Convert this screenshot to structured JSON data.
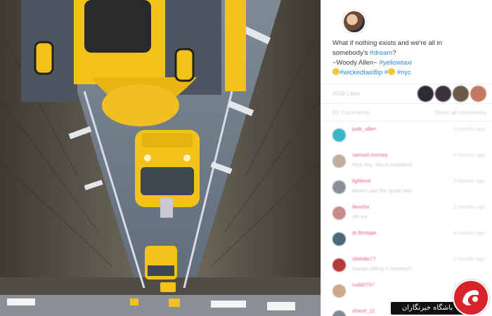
{
  "post": {
    "caption": {
      "line1": "What if nothing exists and we're all in",
      "line2_prefix": "somebody's ",
      "line2_tag": "#dream",
      "line2_suffix": "?",
      "line3_prefix": "~Woody Allen~ ",
      "line3_tag": "#yellowtaxi",
      "line4_tag1": "#wickedtaxiflip",
      "line4_hash": " #",
      "line4_tag2": " #nyc"
    },
    "likes_text": "4538 Likes",
    "comments_count": "93 Comments",
    "show_all": "Show all comments"
  },
  "comments": [
    {
      "user": "jude_allen",
      "text": "",
      "time": "3 months ago",
      "avatar_color": "#3fb3c9"
    },
    {
      "user": "samuel.montoy",
      "text": "Nice this, this is excellent!",
      "time": "3 months ago",
      "avatar_color": "#bfae9d"
    },
    {
      "user": "lightend",
      "text": "Wow! Love the quote too!",
      "time": "3 months ago",
      "avatar_color": "#8a8f98"
    },
    {
      "user": "likeshix",
      "text": "Oh my",
      "time": "3 months ago",
      "avatar_color": "#c98b8b"
    },
    {
      "user": "dr.filmtape",
      "text": "",
      "time": "3 months ago",
      "avatar_color": "#4a6a7a"
    },
    {
      "user": "sitelabs77",
      "text": "Always telling it Sammy!!!",
      "time": "3 months ago",
      "avatar_color": "#b43a3a"
    },
    {
      "user": "rudd2757",
      "text": "",
      "time": "3 months ago",
      "avatar_color": "#c8a98c"
    },
    {
      "user": "sharel_11",
      "text": "",
      "time": "",
      "avatar_color": "#7d8a96"
    }
  ],
  "like_avatar_colors": [
    "#2c2a33",
    "#3b3140",
    "#6b5a48",
    "#c27a64"
  ],
  "watermark": {
    "text": "باشگاه خبرنگاران"
  },
  "colors": {
    "tag": "#2f8bd8",
    "username": "#e05a7a",
    "taxi": "#f2c21b",
    "road": "#6d7987",
    "watermark_red": "#d8232a"
  },
  "icons": [
    "profile-avatar",
    "emoji-icon",
    "newspaper-logo-icon"
  ]
}
